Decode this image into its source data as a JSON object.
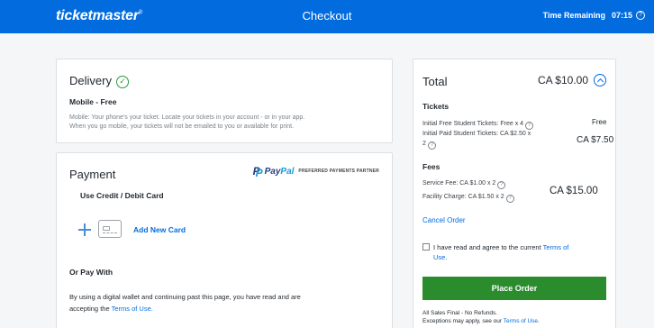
{
  "header": {
    "logo": "ticketmaster",
    "logo_mark": "®",
    "title": "Checkout",
    "timer_label": "Time Remaining",
    "timer_value": "07:15",
    "help_glyph": "?"
  },
  "delivery": {
    "title": "Delivery",
    "method": "Mobile - Free",
    "description_1": "Mobile: Your phone's your ticket. Locate your tickets in your account - or in your app.",
    "description_2": "When you go mobile, your tickets will not be emailed to you or available for print."
  },
  "payment": {
    "title": "Payment",
    "paypal_p": "P",
    "paypal_word_a": "Pay",
    "paypal_word_b": "Pal",
    "paypal_tag": "PREFERRED PAYMENTS PARTNER",
    "credit_debit_label": "Use Credit / Debit Card",
    "add_card_label": "Add New Card",
    "or_pay_with": "Or Pay With",
    "wallet_notice": "By using a digital wallet and continuing past this page, you have read and are",
    "wallet_notice_2": "accepting the",
    "terms_link": "Terms of Use."
  },
  "summary": {
    "total_label": "Total",
    "total_amount": "CA $10.00",
    "tickets_heading": "Tickets",
    "free_line": "Initial Free Student Tickets: Free x 4",
    "free_price": "Free",
    "paid_line": "Initial Paid Student Tickets: CA $2.50 x",
    "paid_line_qty": "2",
    "paid_price": "CA $7.50",
    "fees_heading": "Fees",
    "service_fee": "Service Fee: CA $1.00 x 2",
    "facility_charge": "Facility Charge: CA $1.50 x 2",
    "fees_price": "CA $15.00",
    "cancel_order": "Cancel Order",
    "agree_text": "I have read and agree to the current",
    "agree_link_a": "Terms of",
    "agree_link_b": "Use.",
    "place_order": "Place Order",
    "final_line_1": "All Sales Final - No Refunds.",
    "final_line_2": "Exceptions may apply, see our",
    "final_link": "Terms of Use."
  },
  "colors": {
    "brand_blue": "#026cdf",
    "success_green": "#2b8c2e"
  }
}
